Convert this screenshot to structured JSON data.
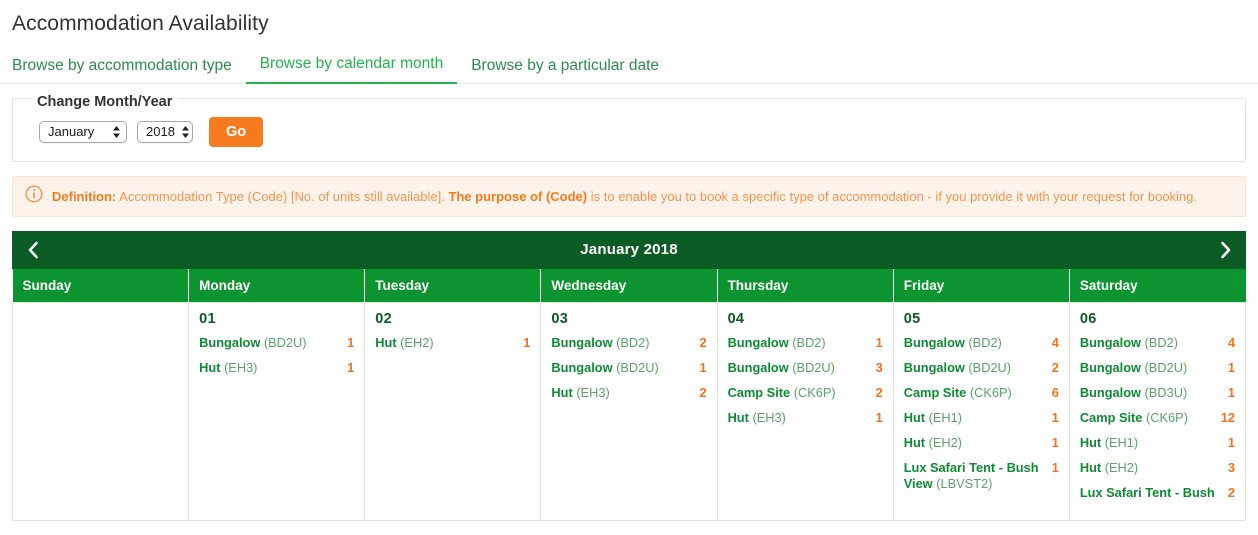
{
  "page": {
    "title": "Accommodation Availability"
  },
  "tabs": [
    {
      "label": "Browse by accommodation type",
      "active": false
    },
    {
      "label": "Browse by calendar month",
      "active": true
    },
    {
      "label": "Browse by a particular date",
      "active": false
    }
  ],
  "filter": {
    "legend": "Change Month/Year",
    "month_value": "January",
    "year_value": "2018",
    "go_label": "Go"
  },
  "banner": {
    "icon": "info-circle-icon",
    "strong_1": "Definition:",
    "text_1": "Accommodation Type (Code) [No. of units still available].",
    "strong_2": "The purpose of (Code)",
    "text_2": "is to enable you to book a specific type of accommodation - if you provide it with your request for booking."
  },
  "calendar": {
    "prev_icon": "chevron-left-icon",
    "next_icon": "chevron-right-icon",
    "title": "January 2018",
    "day_headers": [
      "Sunday",
      "Monday",
      "Tuesday",
      "Wednesday",
      "Thursday",
      "Friday",
      "Saturday"
    ],
    "cells": [
      {
        "day": "",
        "empty": true,
        "entries": []
      },
      {
        "day": "01",
        "empty": false,
        "entries": [
          {
            "name": "Bungalow",
            "code": "(BD2U)",
            "count": "1"
          },
          {
            "name": "Hut",
            "code": "(EH3)",
            "count": "1"
          }
        ]
      },
      {
        "day": "02",
        "empty": false,
        "entries": [
          {
            "name": "Hut",
            "code": "(EH2)",
            "count": "1"
          }
        ]
      },
      {
        "day": "03",
        "empty": false,
        "entries": [
          {
            "name": "Bungalow",
            "code": "(BD2)",
            "count": "2"
          },
          {
            "name": "Bungalow",
            "code": "(BD2U)",
            "count": "1"
          },
          {
            "name": "Hut",
            "code": "(EH3)",
            "count": "2"
          }
        ]
      },
      {
        "day": "04",
        "empty": false,
        "entries": [
          {
            "name": "Bungalow",
            "code": "(BD2)",
            "count": "1"
          },
          {
            "name": "Bungalow",
            "code": "(BD2U)",
            "count": "3"
          },
          {
            "name": "Camp Site",
            "code": "(CK6P)",
            "count": "2"
          },
          {
            "name": "Hut",
            "code": "(EH3)",
            "count": "1"
          }
        ]
      },
      {
        "day": "05",
        "empty": false,
        "entries": [
          {
            "name": "Bungalow",
            "code": "(BD2)",
            "count": "4"
          },
          {
            "name": "Bungalow",
            "code": "(BD2U)",
            "count": "2"
          },
          {
            "name": "Camp Site",
            "code": "(CK6P)",
            "count": "6"
          },
          {
            "name": "Hut",
            "code": "(EH1)",
            "count": "1"
          },
          {
            "name": "Hut",
            "code": "(EH2)",
            "count": "1"
          },
          {
            "name": "Lux Safari Tent - Bush View",
            "code": "(LBVST2)",
            "count": "1"
          }
        ]
      },
      {
        "day": "06",
        "empty": false,
        "entries": [
          {
            "name": "Bungalow",
            "code": "(BD2)",
            "count": "4"
          },
          {
            "name": "Bungalow",
            "code": "(BD2U)",
            "count": "1"
          },
          {
            "name": "Bungalow",
            "code": "(BD3U)",
            "count": "1"
          },
          {
            "name": "Camp Site",
            "code": "(CK6P)",
            "count": "12"
          },
          {
            "name": "Hut",
            "code": "(EH1)",
            "count": "1"
          },
          {
            "name": "Hut",
            "code": "(EH2)",
            "count": "3"
          },
          {
            "name": "Lux Safari Tent - Bush",
            "code": "",
            "count": "2"
          }
        ]
      }
    ]
  },
  "colors": {
    "header_green": "#0a5c24",
    "day_green": "#0b9430",
    "accent_green": "#0f8a35",
    "orange": "#f4711f",
    "go_orange": "#f47b20",
    "empty_cell": "#e3f5de"
  }
}
